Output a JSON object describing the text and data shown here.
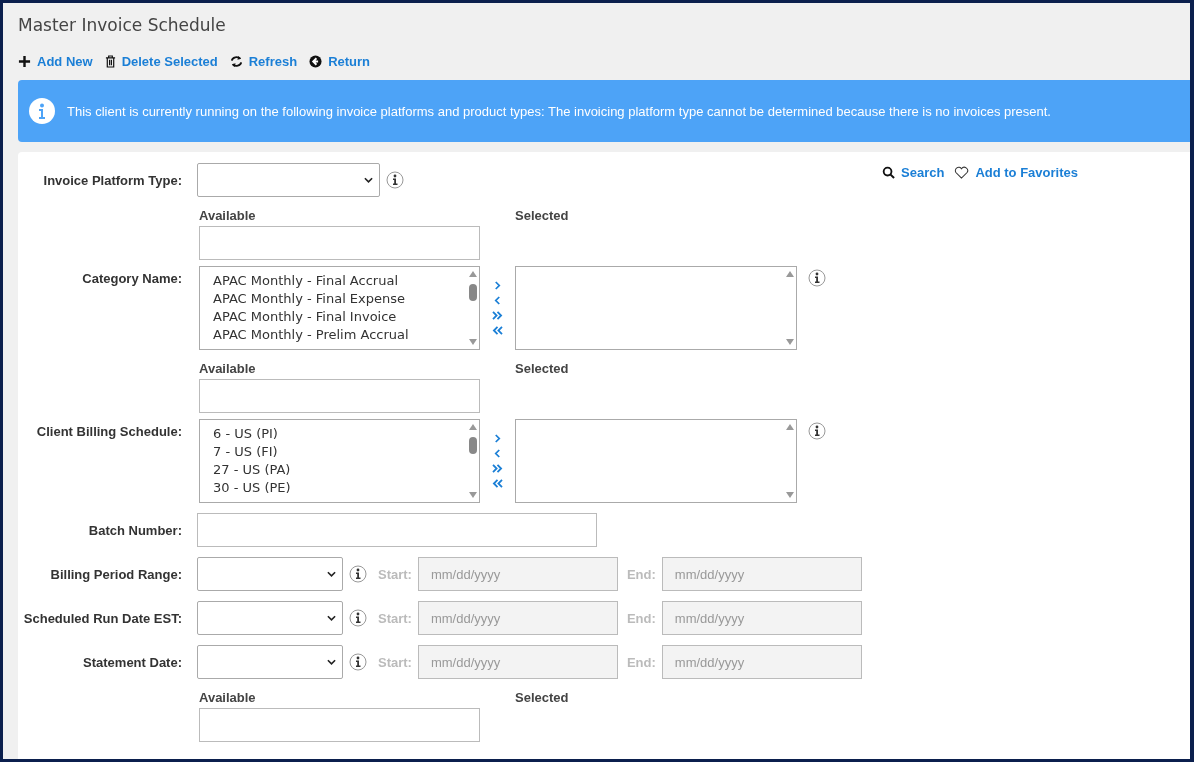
{
  "page": {
    "title": "Master Invoice Schedule"
  },
  "toolbar": [
    {
      "kind": "add",
      "label": "Add New"
    },
    {
      "kind": "delete",
      "label": "Delete Selected"
    },
    {
      "kind": "refresh",
      "label": "Refresh"
    },
    {
      "kind": "return",
      "label": "Return"
    }
  ],
  "alert": {
    "text": "This client is currently running on the following invoice platforms and product types: The invoicing platform type cannot be determined because there is no invoices present."
  },
  "links": [
    {
      "kind": "search",
      "label": "Search"
    },
    {
      "kind": "favorite",
      "label": "Add to Favorites"
    }
  ],
  "rows": [
    {
      "kind": "select",
      "label": "Invoice Platform Type:"
    },
    {
      "kind": "dual",
      "label": "Category Name:",
      "available_heading": "Available",
      "selected_heading": "Selected",
      "available_items": [
        "APAC Monthly - Final Accrual",
        "APAC Monthly - Final Expense",
        "APAC Monthly - Final Invoice",
        "APAC Monthly - Prelim Accrual"
      ]
    },
    {
      "kind": "dual",
      "label": "Client Billing Schedule:",
      "available_heading": "Available",
      "selected_heading": "Selected",
      "available_items": [
        "6 - US (PI)",
        "7 - US (FI)",
        "27 - US (PA)",
        "30 - US (PE)"
      ]
    },
    {
      "kind": "text",
      "label": "Batch Number:"
    },
    {
      "kind": "daterange",
      "label": "Billing Period Range:",
      "start_label": "Start:",
      "start_placeholder": "mm/dd/yyyy",
      "end_label": "End:",
      "end_placeholder": "mm/dd/yyyy",
      "disabled": true
    },
    {
      "kind": "daterange",
      "label": "Scheduled Run Date EST:",
      "start_label": "Start:",
      "start_placeholder": "mm/dd/yyyy",
      "end_label": "End:",
      "end_placeholder": "mm/dd/yyyy",
      "disabled": true
    },
    {
      "kind": "daterange",
      "label": "Statement Date:",
      "start_label": "Start:",
      "start_placeholder": "mm/dd/yyyy",
      "end_label": "End:",
      "end_placeholder": "mm/dd/yyyy",
      "disabled": true
    },
    {
      "kind": "dualhead",
      "available_heading": "Available",
      "selected_heading": "Selected"
    }
  ]
}
